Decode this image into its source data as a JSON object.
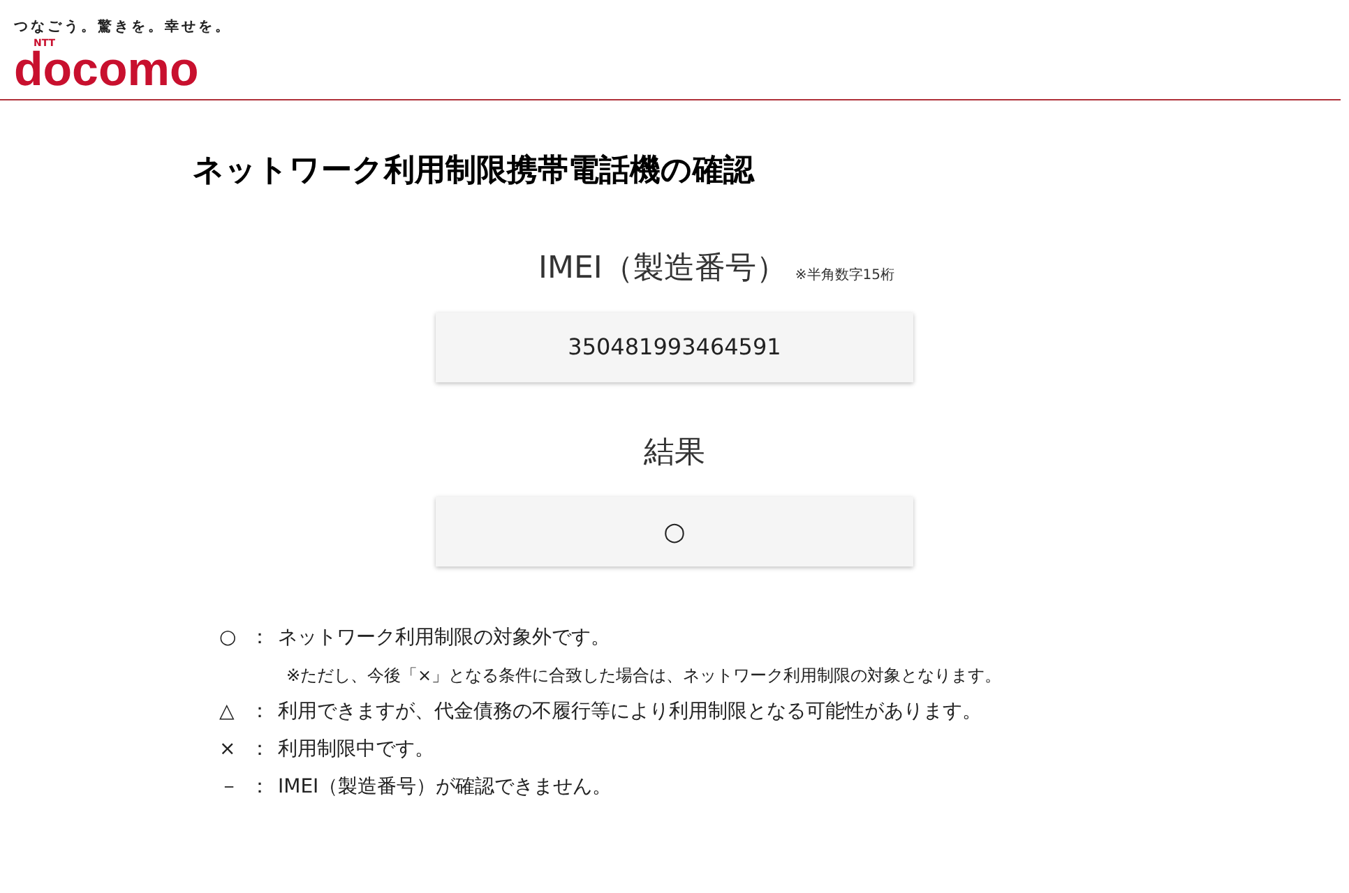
{
  "header": {
    "slogan": "つなごう。驚きを。幸せを。",
    "logo_small": "NTT",
    "logo": "docomo"
  },
  "title": "ネットワーク利用制限携帯電話機の確認",
  "imei": {
    "label": "IMEI（製造番号）",
    "note": "※半角数字15桁",
    "value": "350481993464591"
  },
  "result": {
    "label": "結果",
    "value": "○"
  },
  "legend": [
    {
      "symbol": "○",
      "separator": "：",
      "text": "ネットワーク利用制限の対象外です。",
      "note": "※ただし、今後「×」となる条件に合致した場合は、ネットワーク利用制限の対象となります。"
    },
    {
      "symbol": "△",
      "separator": "：",
      "text": "利用できますが、代金債務の不履行等により利用制限となる可能性があります。"
    },
    {
      "symbol": "×",
      "separator": "：",
      "text": "利用制限中です。"
    },
    {
      "symbol": "－",
      "separator": "：",
      "text": "IMEI（製造番号）が確認できません。"
    }
  ]
}
